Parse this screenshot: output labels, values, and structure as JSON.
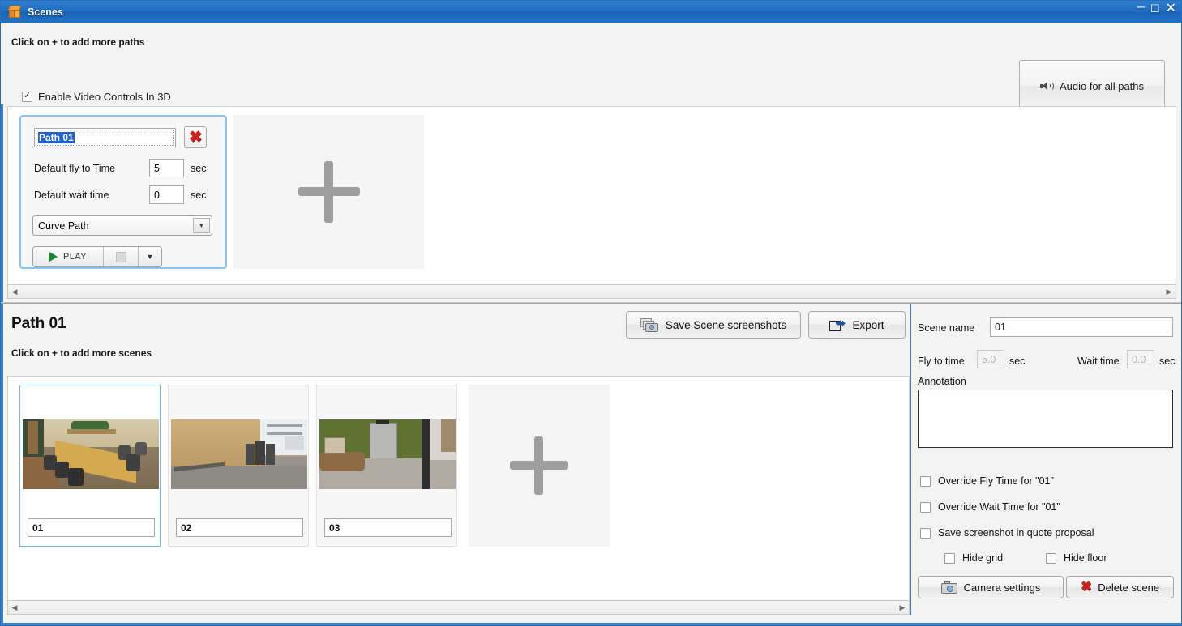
{
  "window": {
    "title": "Scenes",
    "icon": "orange-3d-box-icon",
    "minimize": "–",
    "maximize": "☐",
    "close": "✕",
    "accent_color": "#3f7fc4",
    "titlebar_color": "#1f6ec2"
  },
  "header": {
    "hint": "Click on + to add more paths",
    "enable_video_controls": {
      "label": "Enable Video Controls In 3D",
      "checked": true
    },
    "audio_button": {
      "label": "Audio for all paths",
      "icon": "speaker-icon"
    }
  },
  "paths_panel": {
    "card": {
      "name_value": "Path 01",
      "delete_icon": "red-x-icon",
      "fly_to_time_label": "Default fly to Time",
      "fly_to_time_value": "5",
      "fly_to_time_unit": "sec",
      "wait_time_label": "Default wait time",
      "wait_time_value": "0",
      "wait_time_unit": "sec",
      "path_type": "Curve Path",
      "path_type_arrow": "▼",
      "play_label": "PLAY",
      "play_icon": "play-triangle-icon",
      "stop_icon": "stop-square-icon",
      "dropdown_arrow": "▼"
    },
    "add_path": "+",
    "scroll_left": "◀",
    "scroll_right": "▶"
  },
  "middle": {
    "path_title": "Path 01",
    "hint": "Click on + to add more scenes",
    "save_screenshots_label": "Save Scene screenshots",
    "save_screenshots_icon": "camera-stack-icon",
    "export_label": "Export",
    "export_icon": "export-arrow-icon"
  },
  "scenes_panel": {
    "scenes": [
      {
        "name": "01",
        "selected": true
      },
      {
        "name": "02",
        "selected": false
      },
      {
        "name": "03",
        "selected": false
      }
    ],
    "add_scene": "+",
    "scroll_left": "◀",
    "scroll_right": "▶"
  },
  "right_panel": {
    "scene_name_label": "Scene name",
    "scene_name_value": "01",
    "fly_to_time_label": "Fly to time",
    "fly_to_time_value": "5.0",
    "fly_to_time_unit": "sec",
    "wait_time_label": "Wait time",
    "wait_time_value": "0.0",
    "wait_time_unit": "sec",
    "annotation_label": "Annotation",
    "annotation_value": "",
    "checkboxes": [
      {
        "label": "Override Fly Time for \"01\"",
        "checked": false
      },
      {
        "label": "Override Wait Time for \"01\"",
        "checked": false
      },
      {
        "label": "Save screenshot in quote proposal",
        "checked": false
      },
      {
        "label": "Hide grid",
        "checked": false
      },
      {
        "label": "Hide floor",
        "checked": false
      }
    ],
    "camera_settings_label": "Camera settings",
    "camera_settings_icon": "camera-icon",
    "delete_scene_label": "Delete scene",
    "delete_scene_icon": "red-x-icon"
  }
}
